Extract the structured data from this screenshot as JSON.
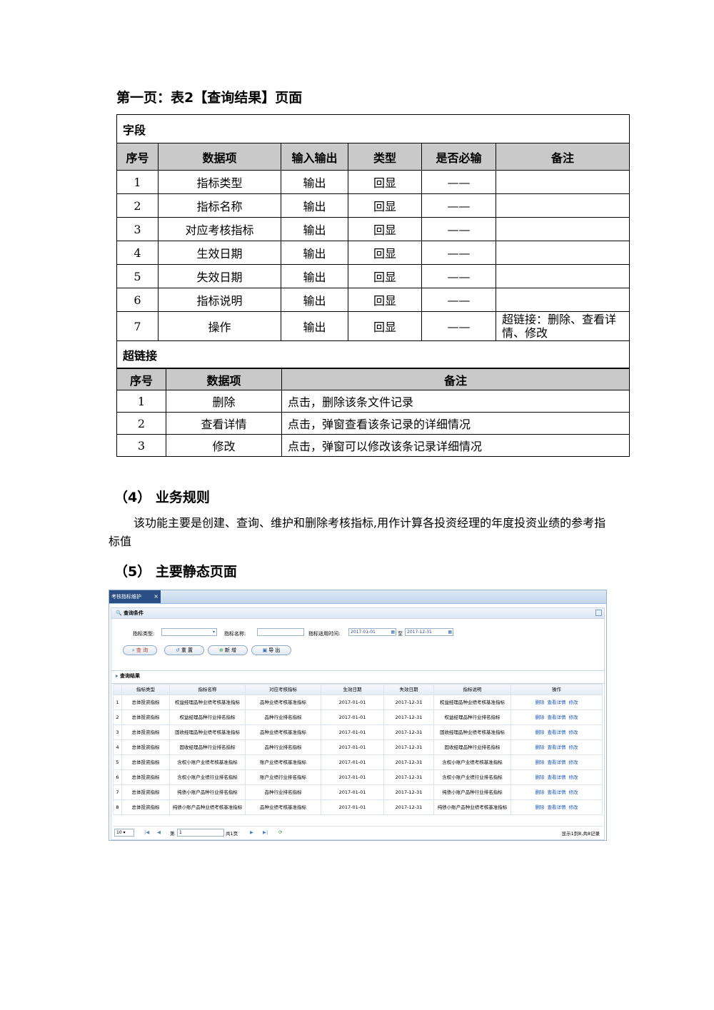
{
  "section_title": "第一页：表2【查询结果】页面",
  "field_table": {
    "section_label": "字段",
    "headers": [
      "序号",
      "数据项",
      "输入输出",
      "类型",
      "是否必输",
      "备注"
    ],
    "rows": [
      {
        "no": "1",
        "item": "指标类型",
        "io": "输出",
        "type": "回显",
        "required": "——",
        "note": ""
      },
      {
        "no": "2",
        "item": "指标名称",
        "io": "输出",
        "type": "回显",
        "required": "——",
        "note": ""
      },
      {
        "no": "3",
        "item": "对应考核指标",
        "io": "输出",
        "type": "回显",
        "required": "——",
        "note": ""
      },
      {
        "no": "4",
        "item": "生效日期",
        "io": "输出",
        "type": "回显",
        "required": "——",
        "note": ""
      },
      {
        "no": "5",
        "item": "失效日期",
        "io": "输出",
        "type": "回显",
        "required": "——",
        "note": ""
      },
      {
        "no": "6",
        "item": "指标说明",
        "io": "输出",
        "type": "回显",
        "required": "——",
        "note": ""
      },
      {
        "no": "7",
        "item": "操作",
        "io": "输出",
        "type": "回显",
        "required": "——",
        "note": "超链接：删除、查看详情、修改"
      }
    ]
  },
  "link_table": {
    "section_label": "超链接",
    "headers": [
      "序号",
      "数据项",
      "备注"
    ],
    "rows": [
      {
        "no": "1",
        "item": "删除",
        "note": "点击，删除该条文件记录"
      },
      {
        "no": "2",
        "item": "查看详情",
        "note": "点击，弹窗查看该条记录的详细情况"
      },
      {
        "no": "3",
        "item": "修改",
        "note": "点击，弹窗可以修改该条记录详细情况"
      }
    ]
  },
  "rules_heading": "（4） 业务规则",
  "rules_text": "该功能主要是创建、查询、维护和删除考核指标,用作计算各投资经理的年度投资业绩的参考指标值",
  "static_heading": "（5） 主要静态页面",
  "screenshot": {
    "tab_label": "考核指标维护",
    "query_panel_title": "查询条件",
    "labels": {
      "type": "指标类型:",
      "name": "指标名称:",
      "period": "指标适用时间:",
      "to": "至"
    },
    "date_from": "2017-01-01",
    "date_to": "2017-12-31",
    "buttons": {
      "query": "查 询",
      "reset": "重 置",
      "add": "新 增",
      "export": "导 出"
    },
    "result_panel_title": "查询结果",
    "grid_headers": [
      "",
      "指标类型",
      "指标名称",
      "对应考核指标",
      "生效日期",
      "失效日期",
      "指标说明",
      "操作"
    ],
    "grid_rows": [
      {
        "no": "1",
        "type": "总体投资指标",
        "name": "权益经理品种业绩考核基准指标",
        "target": "品种业绩考核基准指标",
        "start": "2017-01-01",
        "end": "2017-12-31",
        "desc": "权益经理品种业绩考核基准指标"
      },
      {
        "no": "2",
        "type": "总体投资指标",
        "name": "权益经理品种行业排名指标",
        "target": "品种行业排名指标",
        "start": "2017-01-01",
        "end": "2017-12-31",
        "desc": "权益经理品种行业排名指标"
      },
      {
        "no": "3",
        "type": "总体投资指标",
        "name": "固收经理品种业绩考核基准指标",
        "target": "品种业绩考核基准指标",
        "start": "2017-01-01",
        "end": "2017-12-31",
        "desc": "固收经理品种业绩考核基准指标"
      },
      {
        "no": "4",
        "type": "总体投资指标",
        "name": "固收经理品种行业排名指标",
        "target": "品种行业排名指标",
        "start": "2017-01-01",
        "end": "2017-12-31",
        "desc": "固收经理品种行业排名指标"
      },
      {
        "no": "5",
        "type": "总体投资指标",
        "name": "含权小账户业绩考核基准指标",
        "target": "账户业绩考核基准指标",
        "start": "2017-01-01",
        "end": "2017-12-31",
        "desc": "含权小账户业绩考核基准指标"
      },
      {
        "no": "6",
        "type": "总体投资指标",
        "name": "含权小账户业绩行业排名指标",
        "target": "账户业绩行业排名指标",
        "start": "2017-01-01",
        "end": "2017-12-31",
        "desc": "含权小账户业绩行业排名指标"
      },
      {
        "no": "7",
        "type": "总体投资指标",
        "name": "纯债小账户品种行业排名指标",
        "target": "品种行业排名指标",
        "start": "2017-01-01",
        "end": "2017-12-31",
        "desc": "纯债小账户品种行业排名指标"
      },
      {
        "no": "8",
        "type": "总体投资指标",
        "name": "纯债小账户品种业绩考核基准指标",
        "target": "品种业绩考核基准指标",
        "start": "2017-01-01",
        "end": "2017-12-31",
        "desc": "纯债小账户品种业绩考核基准指标"
      }
    ],
    "row_actions": {
      "delete": "删除",
      "detail": "查看详情",
      "edit": "修改"
    },
    "pager": {
      "page_size": "10",
      "page_prefix": "第",
      "page_value": "1",
      "page_total": "共1页",
      "summary": "显示1到8,共8记录"
    }
  }
}
